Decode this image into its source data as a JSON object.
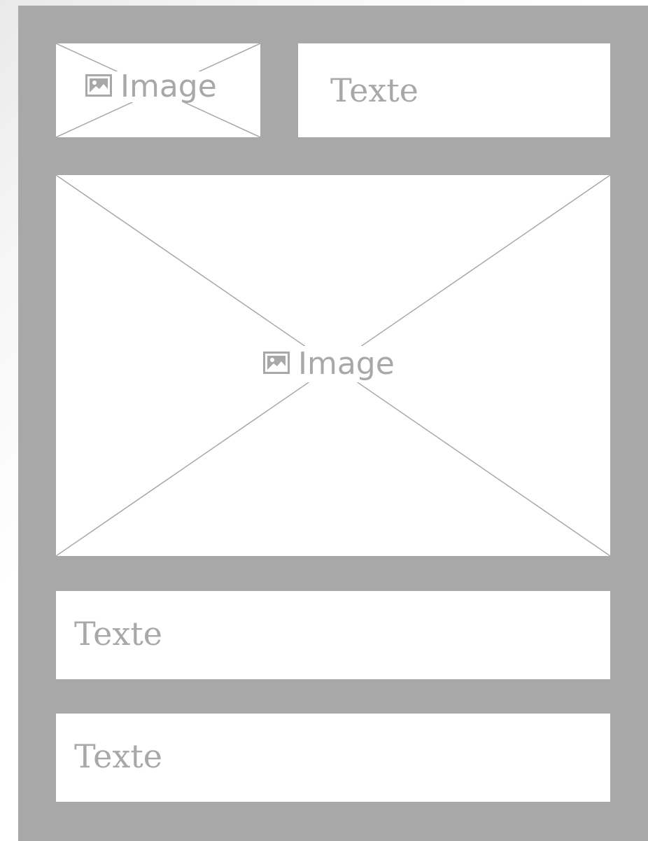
{
  "wireframe": {
    "top_row": {
      "image": {
        "label": "Image",
        "icon": "image-icon"
      },
      "text": {
        "label": "Texte"
      }
    },
    "hero_image": {
      "label": "Image",
      "icon": "image-icon"
    },
    "text_block_1": {
      "label": "Texte"
    },
    "text_block_2": {
      "label": "Texte"
    }
  },
  "colors": {
    "frame": "#a8a8a8",
    "placeholder_text": "#a8a8a8",
    "box_fill": "#ffffff"
  }
}
